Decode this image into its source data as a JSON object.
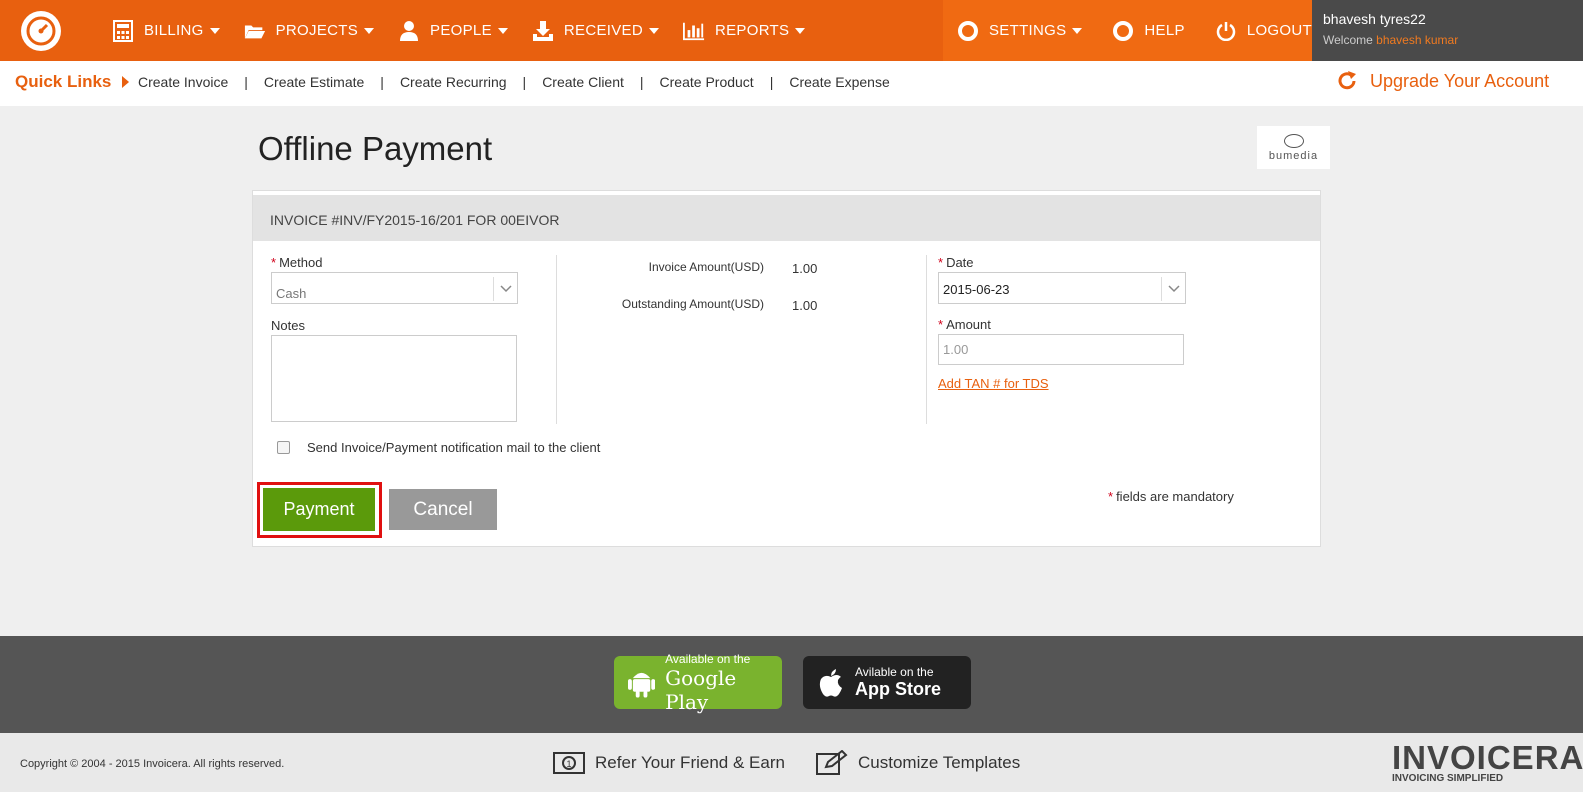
{
  "topnav": {
    "items": [
      {
        "label": "BILLING",
        "icon": "calculator-icon"
      },
      {
        "label": "PROJECTS",
        "icon": "folder-icon"
      },
      {
        "label": "PEOPLE",
        "icon": "person-icon"
      },
      {
        "label": "RECEIVED",
        "icon": "download-icon"
      },
      {
        "label": "REPORTS",
        "icon": "bar-chart-icon"
      }
    ],
    "right": [
      {
        "label": "SETTINGS",
        "icon": "lifebuoy-icon"
      },
      {
        "label": "HELP",
        "icon": "lifebuoy-icon"
      },
      {
        "label": "LOGOUT",
        "icon": "power-icon"
      }
    ],
    "user": {
      "name": "bhavesh tyres22",
      "welcome_prefix": "Welcome",
      "welcome_name": "bhavesh kumar"
    }
  },
  "quicklinks": {
    "title": "Quick Links",
    "links": [
      "Create Invoice",
      "Create Estimate",
      "Create Recurring",
      "Create Client",
      "Create Product",
      "Create Expense"
    ],
    "upgrade": "Upgrade Your Account"
  },
  "page": {
    "title": "Offline Payment",
    "brand_logo_text": "bumedia"
  },
  "form": {
    "header": "INVOICE #INV/FY2015-16/201 FOR 00EIVOR",
    "method_label": "Method",
    "method_value": "Cash",
    "notes_label": "Notes",
    "invoice_amount_label": "Invoice Amount(USD)",
    "invoice_amount_value": "1.00",
    "outstanding_amount_label": "Outstanding Amount(USD)",
    "outstanding_amount_value": "1.00",
    "date_label": "Date",
    "date_value": "2015-06-23",
    "amount_label": "Amount",
    "amount_placeholder": "1.00",
    "tan_link": "Add TAN # for TDS",
    "notify_label": "Send Invoice/Payment notification mail to the client",
    "payment_button": "Payment",
    "cancel_button": "Cancel",
    "mandatory_note": "fields are mandatory",
    "required_mark": "*"
  },
  "footer": {
    "google_play": {
      "small": "Available on the",
      "big": "Google Play"
    },
    "app_store": {
      "small": "Avilable on the",
      "big": "App Store"
    },
    "copyright": "Copyright © 2004 - 2015 Invoicera. All rights reserved.",
    "refer": "Refer Your Friend & Earn",
    "customize": "Customize Templates",
    "brand": "INVOICERA",
    "tagline": "INVOICING SIMPLIFIED"
  },
  "colors": {
    "accent": "#e8600f",
    "payment_green": "#5b9a0b",
    "highlight_red": "#e01010"
  }
}
